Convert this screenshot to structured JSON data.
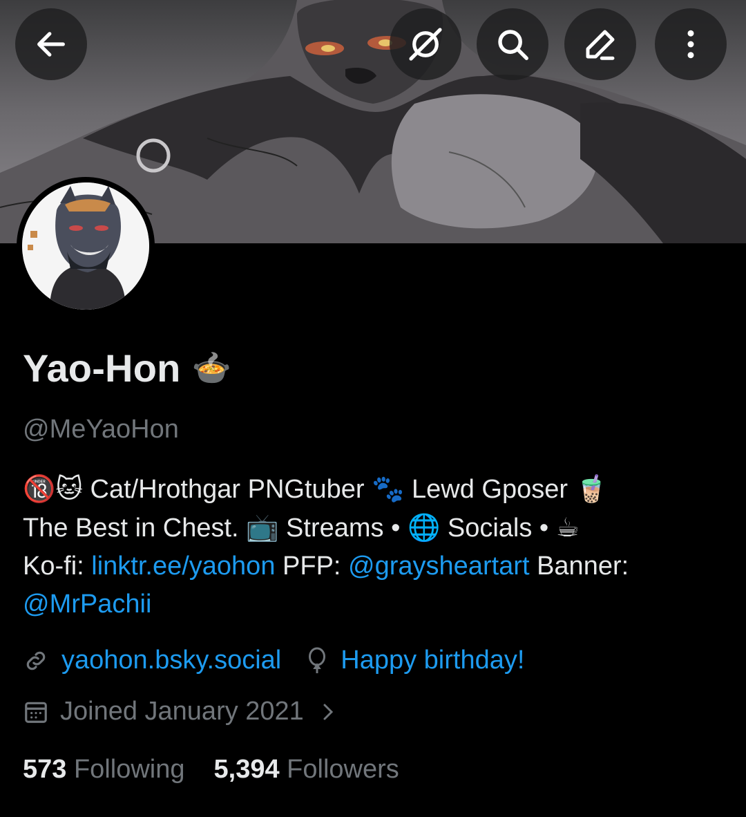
{
  "header": {
    "back_icon": "arrow-left-icon",
    "grok_icon": "grok-icon",
    "search_icon": "search-icon",
    "edit_icon": "pencil-icon",
    "more_icon": "more-vertical-icon"
  },
  "profile": {
    "display_name": "Yao-Hon",
    "name_emoji": "🍲",
    "handle": "@MeYaoHon",
    "bio": {
      "line1_text_a": "Cat/Hrothgar PNGtuber",
      "line1_emoji_a": "🔞🐱",
      "line1_emoji_b": "🐾",
      "line1_text_b": "Lewd Gposer",
      "line1_emoji_c": "🧋",
      "line2_text_a": "The Best in Chest.",
      "line2_emoji_a": "📺",
      "line2_text_b": "Streams •",
      "line2_emoji_b": "🌐",
      "line2_text_c": "Socials •",
      "line2_emoji_c": "☕",
      "line3_text_a": "Ko-fi:",
      "line3_link_a": "linktr.ee/yaohon",
      "line3_text_b": "PFP:",
      "line3_link_b": "@graysheartart",
      "line3_text_c": "Banner:",
      "line4_link": "@MrPachii"
    },
    "website": "yaohon.bsky.social",
    "birthday": "Happy birthday!",
    "joined": "Joined January 2021",
    "following_count": "573",
    "following_label": "Following",
    "followers_count": "5,394",
    "followers_label": "Followers"
  },
  "colors": {
    "background": "#000000",
    "text": "#e7e9ea",
    "muted": "#71767b",
    "accent": "#1d9bf0"
  }
}
